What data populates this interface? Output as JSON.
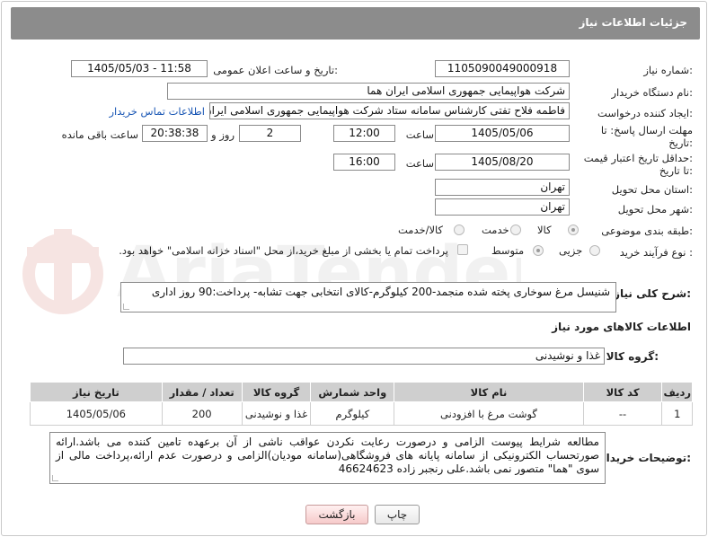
{
  "panel": {
    "title": "جزئیات اطلاعات نیاز"
  },
  "fields": {
    "need_number": {
      "label": "شماره نیاز:",
      "value": "1105090049000918"
    },
    "announce_datetime": {
      "label": "تاریخ و ساعت اعلان عمومی:",
      "value": "1405/05/03 - 11:58"
    },
    "buyer_org": {
      "label": "نام دستگاه خریدار:",
      "value": "شرکت هواپیمایی جمهوری اسلامی ایران هما"
    },
    "requester": {
      "label": "ایجاد کننده درخواست:",
      "value": "فاطمه فلاح تفتی کارشناس سامانه ستاد شرکت هواپیمایی جمهوری اسلامی ایران",
      "contact_link": "اطلاعات تماس خریدار"
    },
    "reply_deadline": {
      "label_line1": "مهلت ارسال پاسخ: تا",
      "label_line2": "تاریخ:",
      "date": "1405/05/06",
      "time_label": "ساعت",
      "time": "12:00",
      "days": "2",
      "days_label": "روز و",
      "remaining": "20:38:38",
      "remaining_label": "ساعت باقی مانده"
    },
    "price_validity": {
      "label_line1": "حداقل تاریخ اعتبار قیمت:",
      "label_line2": "تا تاریخ:",
      "date": "1405/08/20",
      "time_label": "ساعت",
      "time": "16:00"
    },
    "delivery_province": {
      "label": "استان محل تحویل:",
      "value": "تهران"
    },
    "delivery_city": {
      "label": "شهر محل تحویل:",
      "value": "تهران"
    },
    "category": {
      "label": "طبقه بندی موضوعی:",
      "options": [
        "کالا",
        "خدمت",
        "کالا/خدمت"
      ],
      "selected": "کالا"
    },
    "purchase_type": {
      "label": "نوع فرآیند خرید :",
      "options": [
        "جزیی",
        "متوسط"
      ],
      "selected": "متوسط",
      "note": "پرداخت تمام یا بخشی از مبلغ خرید،از محل \"اسناد خزانه اسلامی\" خواهد بود."
    }
  },
  "summary": {
    "label": "شرح کلی نیاز:",
    "value": "شنیسل مرغ سوخاری پخته شده منجمد-200 کیلوگرم-کالای انتخابی جهت تشابه- پرداخت:90 روز اداری"
  },
  "goods_section": {
    "title": "اطلاعات کالاهای مورد نیاز",
    "group_label": "گروه کالا:",
    "group_value": "غذا و نوشیدنی",
    "columns": [
      "ردیف",
      "کد کالا",
      "نام کالا",
      "واحد شمارش",
      "گروه کالا",
      "تعداد / مقدار",
      "تاریخ نیاز"
    ],
    "rows": [
      [
        "1",
        "--",
        "گوشت مرغ با افزودنی",
        "کیلوگرم",
        "غذا و نوشیدنی",
        "200",
        "1405/05/06"
      ]
    ]
  },
  "buyer_notes": {
    "label": "توضیحات خریدار:",
    "value": "مطالعه شرایط پیوست الزامی و درصورت رعایت نکردن عواقب ناشی از آن برعهده تامین کننده می باشد.ارائه صورتحساب الکترونیکی از سامانه پایانه های فروشگاهی(سامانه مودیان)الزامی و درصورت عدم ارائه،پرداخت مالی از سوی \"هما\" متصور نمی باشد.علی رنجبر زاده 46624623"
  },
  "buttons": {
    "print": "چاپ",
    "back": "بازگشت"
  },
  "watermark": {
    "text": "AriaTender.net",
    "color": "#c0392b"
  },
  "colors": {
    "header": "#8c8c8c",
    "link": "#1a57b5",
    "table_header": "#cfcfcf"
  }
}
